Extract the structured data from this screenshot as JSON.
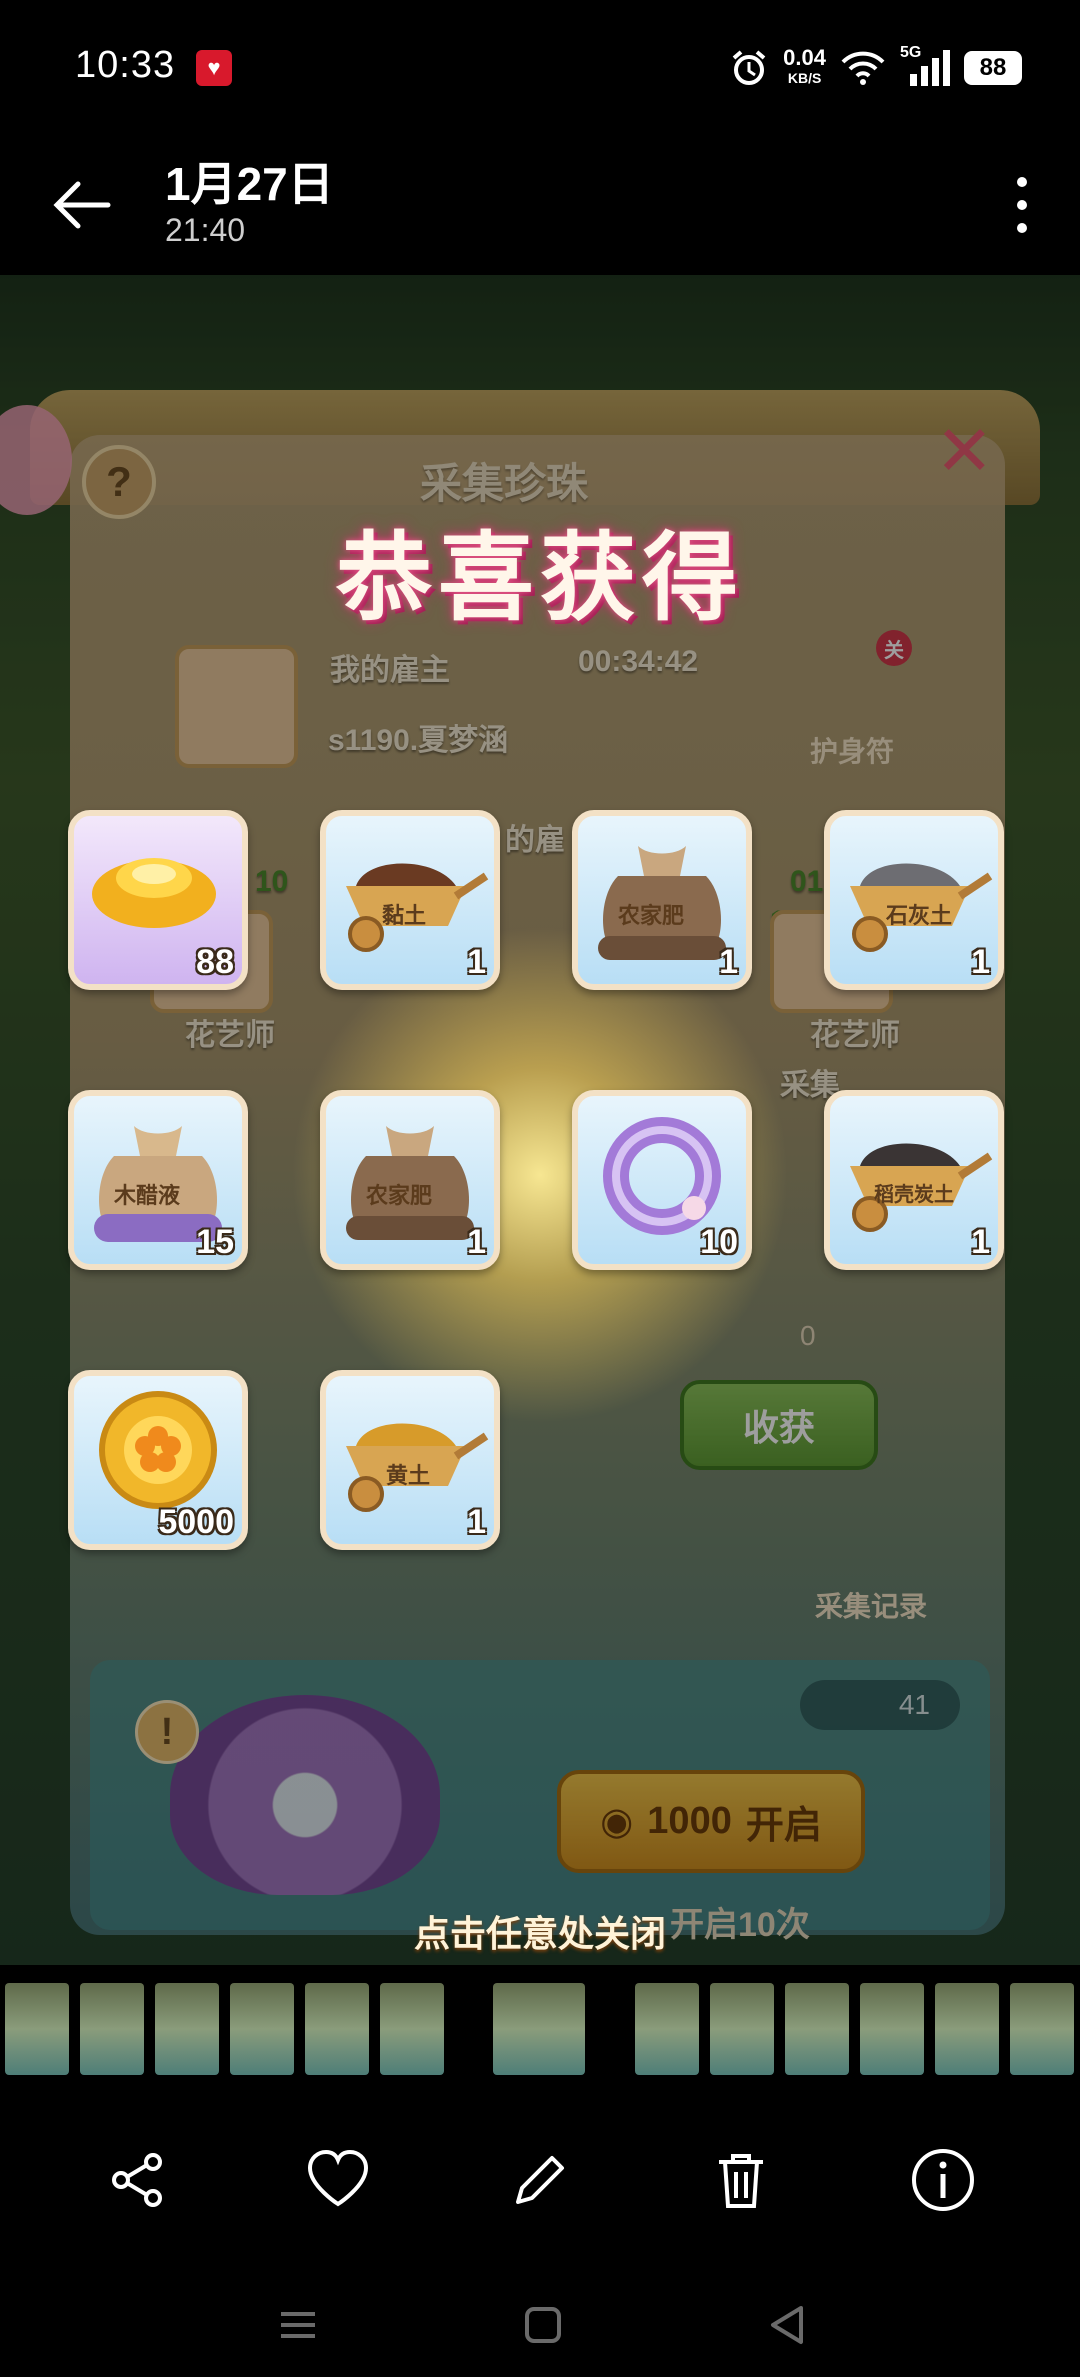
{
  "status_bar": {
    "time": "10:33",
    "network_speed": "0.04",
    "network_unit": "KB/S",
    "network_type": "5G",
    "battery": "88"
  },
  "header": {
    "title": "1月27日",
    "subtitle": "21:40"
  },
  "game": {
    "headline": "恭喜获得",
    "banner_title": "采集珍珠",
    "employer_label": "我的雇主",
    "timer": "00:34:42",
    "employer_name": "s1190.夏梦涵",
    "amulet_label": "护身符",
    "amulet_badge": "关",
    "employees_label": "的雇",
    "collect_button": "收获",
    "shell_count": "0",
    "record_label": "采集记录",
    "pearl_count": "41",
    "open_cost": "1000",
    "open_button": "开启",
    "open_ten": "开启10次",
    "tap_to_close": "点击任意处关闭",
    "bg_numbers": [
      "10",
      "01",
      "1"
    ],
    "bg_titles": [
      "花艺师",
      "花艺师"
    ],
    "bg_partial": "采集"
  },
  "rewards": [
    {
      "name": "元宝",
      "label": "",
      "qty": "88",
      "icon": "gold-ingot-icon"
    },
    {
      "name": "黏土",
      "label": "黏土",
      "qty": "1",
      "icon": "wheelbarrow-clay-icon"
    },
    {
      "name": "农家肥",
      "label": "农家肥",
      "qty": "1",
      "icon": "fertilizer-sack-icon"
    },
    {
      "name": "石灰土",
      "label": "石灰土",
      "qty": "1",
      "icon": "wheelbarrow-lime-icon"
    },
    {
      "name": "木醋液",
      "label": "木醋液",
      "qty": "15",
      "icon": "purple-sack-icon"
    },
    {
      "name": "农家肥",
      "label": "农家肥",
      "qty": "1",
      "icon": "fertilizer-sack-icon"
    },
    {
      "name": "紫色圆环",
      "label": "",
      "qty": "10",
      "icon": "purple-ring-icon"
    },
    {
      "name": "稻壳炭土",
      "label": "稻壳炭土",
      "qty": "1",
      "icon": "wheelbarrow-charcoal-icon"
    },
    {
      "name": "铜钱",
      "label": "",
      "qty": "5000",
      "icon": "flower-coin-icon"
    },
    {
      "name": "黄土",
      "label": "黄土",
      "qty": "1",
      "icon": "wheelbarrow-loess-icon"
    }
  ],
  "colors": {
    "accent_pink": "#e25a86",
    "tile_blue": "#b8def5",
    "button_green": "#6fae44",
    "button_gold": "#e5b03a"
  },
  "actions": [
    "share-icon",
    "favorite-icon",
    "edit-icon",
    "delete-icon",
    "info-icon"
  ],
  "nav": [
    "menu-icon",
    "home-icon",
    "back-icon"
  ]
}
